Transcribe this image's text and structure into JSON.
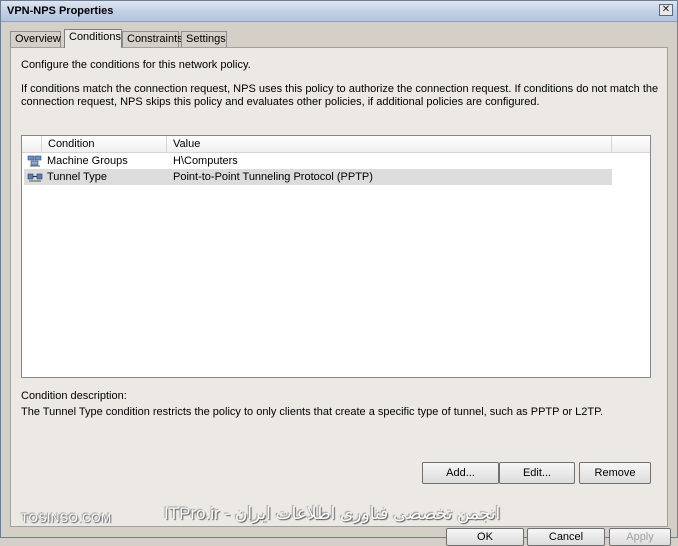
{
  "window": {
    "title": "VPN-NPS Properties",
    "close_glyph": "✕"
  },
  "tabs": [
    {
      "label": "Overview"
    },
    {
      "label": "Conditions"
    },
    {
      "label": "Constraints"
    },
    {
      "label": "Settings"
    }
  ],
  "panel": {
    "intro": "Configure the conditions for this network policy.",
    "help_line1": "If conditions match the connection request, NPS uses this policy to authorize the connection request. If conditions do not match the",
    "help_line2": "connection request, NPS skips this policy and evaluates other policies, if additional policies are configured."
  },
  "conditions_table": {
    "columns": [
      "Condition",
      "Value"
    ],
    "rows": [
      {
        "icon": "machine-groups-icon",
        "condition": "Machine Groups",
        "value": "H\\Computers",
        "selected": false
      },
      {
        "icon": "tunnel-type-icon",
        "condition": "Tunnel Type",
        "value": "Point-to-Point Tunneling Protocol (PPTP)",
        "selected": true
      }
    ]
  },
  "description": {
    "label": "Condition description:",
    "text": "The Tunnel Type condition restricts the policy to only clients that create a specific type of tunnel, such as PPTP or L2TP."
  },
  "buttons": {
    "add": "Add...",
    "edit": "Edit...",
    "remove": "Remove",
    "ok": "OK",
    "cancel": "Cancel",
    "apply": "Apply"
  },
  "watermark": {
    "left": "TOSINSO.COM",
    "right": "ITPro.ir - انجمن تخصصی فناوری اطلاعات ایران"
  }
}
